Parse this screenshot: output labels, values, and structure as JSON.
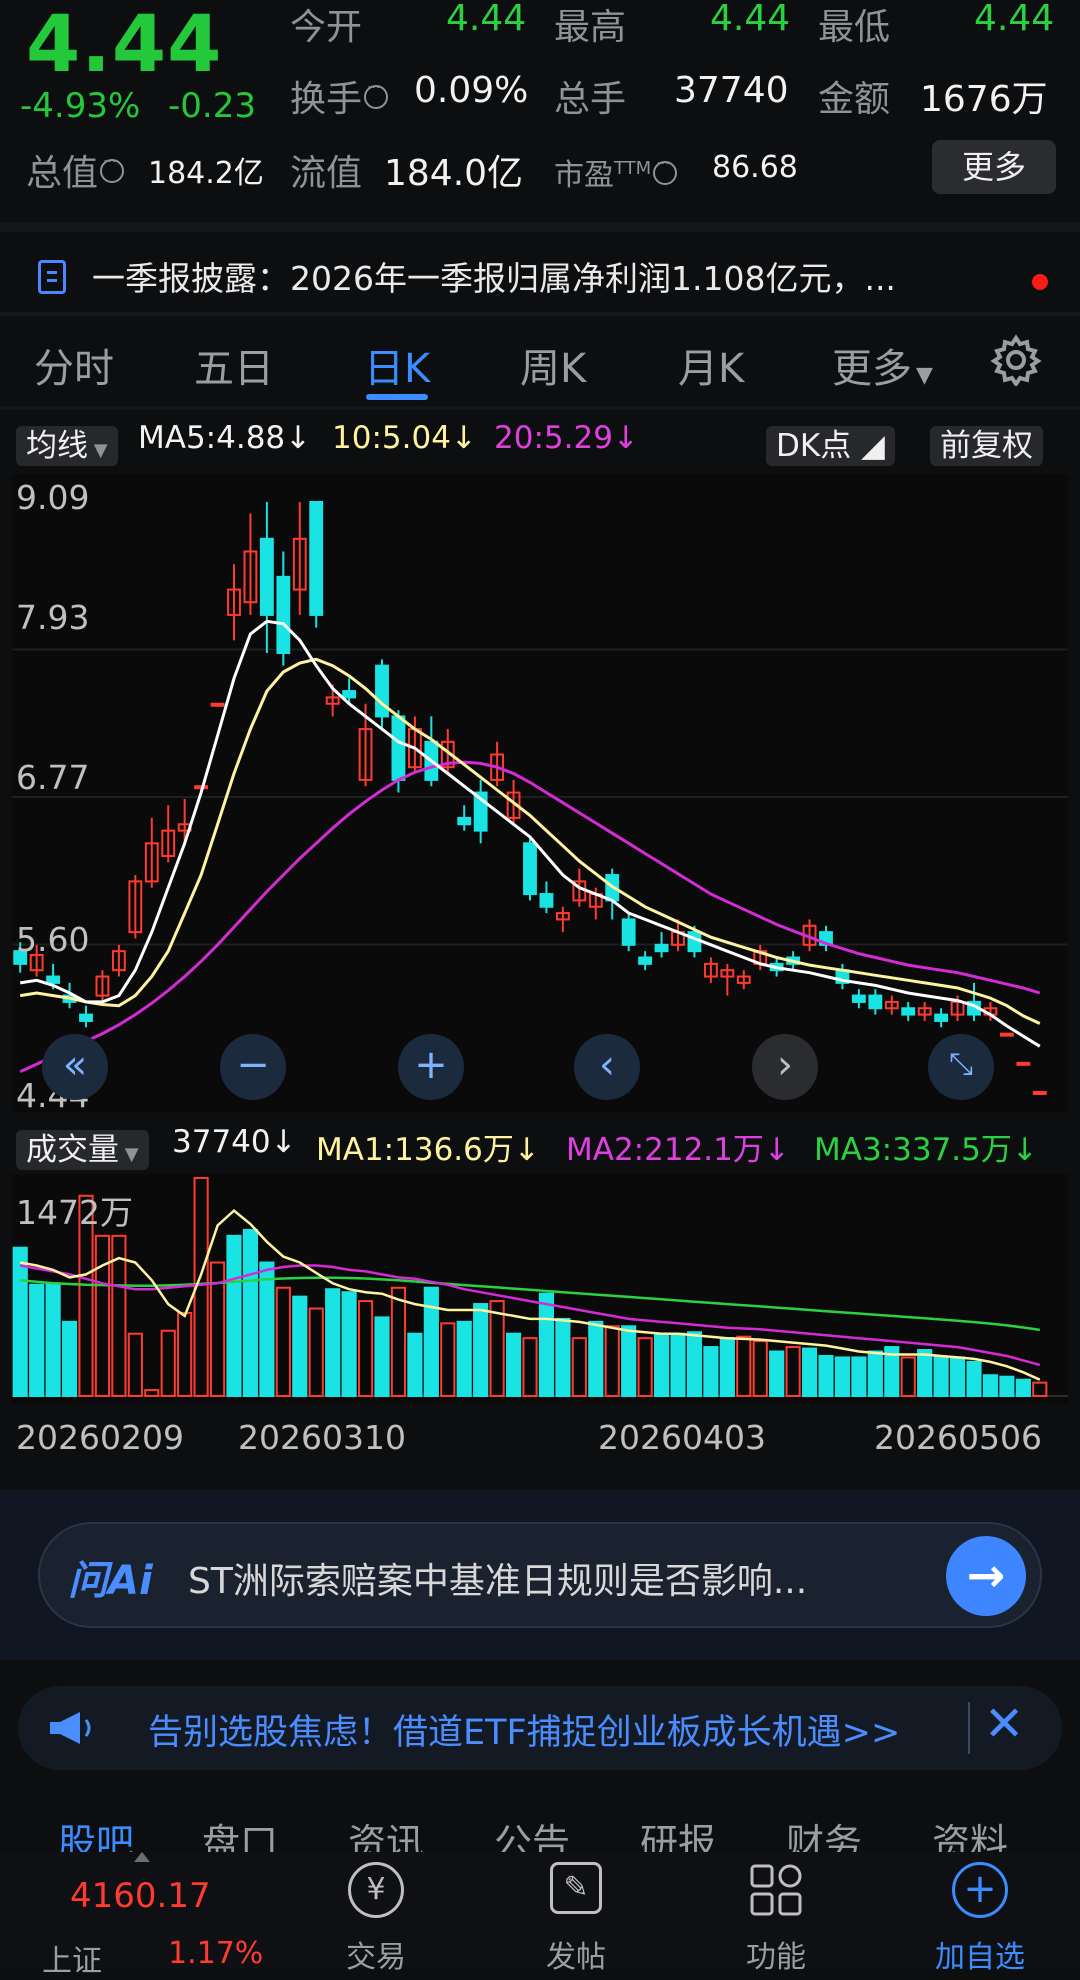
{
  "quote": {
    "price": "4.44",
    "change_pct": "-4.93%",
    "change_amt": "-0.23",
    "open_label": "今开",
    "open_value": "4.44",
    "high_label": "最高",
    "high_value": "4.44",
    "low_label": "最低",
    "low_value": "4.44",
    "turnover_label": "换手",
    "turnover_value": "0.09%",
    "volume_label": "总手",
    "volume_value": "37740",
    "amount_label": "金额",
    "amount_value": "1676万",
    "mcap_label": "总值",
    "mcap_value": "184.2亿",
    "float_label": "流值",
    "float_value": "184.0亿",
    "pe_label": "市盈",
    "pe_sup": "TTM",
    "pe_value": "86.68",
    "more_label": "更多"
  },
  "notice": {
    "text": "一季报披露：2026年一季报归属净利润1.108亿元，..."
  },
  "tabs": [
    "分时",
    "五日",
    "日K",
    "周K",
    "月K",
    "更多"
  ],
  "active_tab": "日K",
  "ma_row": {
    "selector": "均线",
    "ma5": "MA5:4.88",
    "ma10": "10:5.04",
    "ma20": "20:5.29",
    "dk": "DK点",
    "adjust": "前复权"
  },
  "price_axis": [
    "9.09",
    "7.93",
    "6.77",
    "5.60",
    "4.44"
  ],
  "vol_row": {
    "selector": "成交量",
    "vol": "37740",
    "ma1": "MA1:136.6万",
    "ma2": "MA2:212.1万",
    "ma3": "MA3:337.5万"
  },
  "vol_axis_max": "1472万",
  "dates": [
    "20260209",
    "20260310",
    "20260403",
    "20260506"
  ],
  "chart_data": {
    "type": "candlestick",
    "y_range": [
      4.44,
      9.09
    ],
    "candles": [
      [
        5.55,
        5.45,
        5.62,
        5.38
      ],
      [
        5.4,
        5.52,
        5.6,
        5.35
      ],
      [
        5.35,
        5.3,
        5.45,
        5.25
      ],
      [
        5.2,
        5.15,
        5.3,
        5.1
      ],
      [
        5.05,
        5.0,
        5.12,
        4.95
      ],
      [
        5.2,
        5.35,
        5.4,
        5.15
      ],
      [
        5.4,
        5.55,
        5.6,
        5.35
      ],
      [
        5.7,
        6.1,
        6.15,
        5.65
      ],
      [
        6.1,
        6.4,
        6.6,
        6.05
      ],
      [
        6.3,
        6.5,
        6.7,
        6.25
      ],
      [
        6.5,
        6.55,
        6.75,
        6.4
      ],
      [
        6.85,
        6.85,
        6.85,
        6.85
      ],
      [
        7.5,
        7.5,
        7.5,
        7.5
      ],
      [
        8.2,
        8.4,
        8.6,
        8.0
      ],
      [
        8.3,
        8.7,
        9.0,
        8.2
      ],
      [
        8.8,
        8.2,
        9.09,
        7.9
      ],
      [
        8.5,
        7.9,
        8.7,
        7.8
      ],
      [
        8.4,
        8.8,
        9.09,
        8.2
      ],
      [
        9.09,
        8.2,
        9.09,
        8.1
      ],
      [
        7.5,
        7.55,
        7.65,
        7.4
      ],
      [
        7.6,
        7.55,
        7.7,
        7.5
      ],
      [
        6.9,
        7.3,
        7.5,
        6.85
      ],
      [
        7.8,
        7.4,
        7.85,
        7.3
      ],
      [
        7.4,
        6.9,
        7.45,
        6.8
      ],
      [
        7.0,
        7.3,
        7.4,
        6.95
      ],
      [
        7.2,
        6.9,
        7.4,
        6.85
      ],
      [
        7.0,
        7.2,
        7.3,
        6.95
      ],
      [
        6.6,
        6.55,
        6.7,
        6.5
      ],
      [
        6.8,
        6.5,
        6.9,
        6.4
      ],
      [
        6.9,
        7.1,
        7.2,
        6.85
      ],
      [
        6.6,
        6.8,
        6.9,
        6.55
      ],
      [
        6.4,
        6.0,
        6.45,
        5.95
      ],
      [
        6.0,
        5.9,
        6.1,
        5.85
      ],
      [
        5.8,
        5.85,
        5.9,
        5.7
      ],
      [
        5.95,
        6.1,
        6.2,
        5.9
      ],
      [
        5.9,
        6.0,
        6.05,
        5.8
      ],
      [
        6.15,
        5.95,
        6.2,
        5.8
      ],
      [
        5.8,
        5.6,
        5.85,
        5.55
      ],
      [
        5.5,
        5.45,
        5.55,
        5.4
      ],
      [
        5.6,
        5.55,
        5.7,
        5.5
      ],
      [
        5.6,
        5.7,
        5.8,
        5.55
      ],
      [
        5.7,
        5.55,
        5.75,
        5.5
      ],
      [
        5.35,
        5.45,
        5.5,
        5.3
      ],
      [
        5.35,
        5.4,
        5.45,
        5.2
      ],
      [
        5.3,
        5.35,
        5.4,
        5.25
      ],
      [
        5.45,
        5.55,
        5.6,
        5.4
      ],
      [
        5.45,
        5.4,
        5.5,
        5.35
      ],
      [
        5.5,
        5.45,
        5.55,
        5.4
      ],
      [
        5.6,
        5.75,
        5.8,
        5.55
      ],
      [
        5.7,
        5.6,
        5.75,
        5.55
      ],
      [
        5.4,
        5.3,
        5.45,
        5.25
      ],
      [
        5.2,
        5.15,
        5.25,
        5.1
      ],
      [
        5.2,
        5.1,
        5.25,
        5.05
      ],
      [
        5.1,
        5.15,
        5.2,
        5.05
      ],
      [
        5.1,
        5.05,
        5.15,
        5.0
      ],
      [
        5.05,
        5.1,
        5.15,
        5.0
      ],
      [
        5.05,
        5.0,
        5.1,
        4.95
      ],
      [
        5.05,
        5.15,
        5.2,
        5.0
      ],
      [
        5.15,
        5.05,
        5.3,
        5.0
      ],
      [
        5.05,
        5.1,
        5.15,
        5.0
      ],
      [
        4.9,
        4.9,
        4.9,
        4.9
      ],
      [
        4.67,
        4.67,
        4.67,
        4.67
      ],
      [
        4.44,
        4.44,
        4.44,
        4.44
      ]
    ],
    "ma5": [
      5.3,
      5.32,
      5.28,
      5.22,
      5.15,
      5.15,
      5.2,
      5.4,
      5.7,
      6.05,
      6.4,
      6.8,
      7.25,
      7.7,
      8.05,
      8.15,
      8.13,
      8.0,
      7.8,
      7.62,
      7.5,
      7.4,
      7.3,
      7.2,
      7.15,
      7.05,
      6.95,
      6.85,
      6.75,
      6.65,
      6.55,
      6.45,
      6.3,
      6.15,
      6.05,
      6.0,
      5.95,
      5.85,
      5.8,
      5.75,
      5.7,
      5.65,
      5.6,
      5.55,
      5.5,
      5.45,
      5.42,
      5.4,
      5.38,
      5.35,
      5.32,
      5.3,
      5.28,
      5.25,
      5.22,
      5.2,
      5.18,
      5.16,
      5.12,
      5.05,
      4.96,
      4.88,
      4.8
    ],
    "ma10": [
      5.2,
      5.22,
      5.2,
      5.18,
      5.15,
      5.13,
      5.12,
      5.2,
      5.35,
      5.55,
      5.85,
      6.15,
      6.55,
      6.95,
      7.3,
      7.6,
      7.75,
      7.82,
      7.85,
      7.8,
      7.72,
      7.62,
      7.5,
      7.4,
      7.3,
      7.22,
      7.12,
      7.02,
      6.92,
      6.82,
      6.72,
      6.62,
      6.5,
      6.38,
      6.26,
      6.16,
      6.06,
      5.98,
      5.9,
      5.84,
      5.78,
      5.72,
      5.66,
      5.62,
      5.58,
      5.54,
      5.5,
      5.47,
      5.44,
      5.42,
      5.4,
      5.38,
      5.36,
      5.34,
      5.32,
      5.3,
      5.28,
      5.26,
      5.22,
      5.18,
      5.12,
      5.04,
      4.98
    ],
    "ma20": [
      4.6,
      4.66,
      4.72,
      4.78,
      4.84,
      4.9,
      4.97,
      5.05,
      5.14,
      5.24,
      5.35,
      5.47,
      5.6,
      5.74,
      5.88,
      6.02,
      6.15,
      6.28,
      6.4,
      6.52,
      6.63,
      6.73,
      6.82,
      6.9,
      6.96,
      7.0,
      7.03,
      7.04,
      7.03,
      7.0,
      6.95,
      6.88,
      6.8,
      6.72,
      6.64,
      6.56,
      6.48,
      6.4,
      6.32,
      6.24,
      6.16,
      6.08,
      6.0,
      5.94,
      5.88,
      5.82,
      5.76,
      5.71,
      5.66,
      5.61,
      5.57,
      5.53,
      5.5,
      5.47,
      5.44,
      5.42,
      5.4,
      5.38,
      5.35,
      5.32,
      5.29,
      5.26,
      5.22
    ],
    "volumes": [
      1000,
      750,
      760,
      500,
      1350,
      1080,
      1080,
      420,
      40,
      440,
      560,
      1470,
      900,
      1080,
      1120,
      900,
      730,
      670,
      590,
      720,
      700,
      640,
      530,
      730,
      420,
      730,
      490,
      500,
      620,
      640,
      420,
      390,
      690,
      520,
      390,
      500,
      470,
      470,
      390,
      420,
      420,
      430,
      330,
      390,
      400,
      370,
      300,
      330,
      320,
      270,
      260,
      260,
      300,
      330,
      260,
      310,
      260,
      260,
      230,
      140,
      130,
      110,
      90
    ],
    "volume_up": [
      false,
      false,
      false,
      false,
      true,
      true,
      true,
      true,
      true,
      true,
      true,
      true,
      true,
      false,
      false,
      false,
      true,
      false,
      true,
      false,
      false,
      true,
      false,
      true,
      false,
      false,
      true,
      false,
      false,
      true,
      false,
      true,
      false,
      false,
      true,
      false,
      true,
      false,
      true,
      false,
      false,
      false,
      false,
      false,
      true,
      true,
      false,
      true,
      false,
      false,
      false,
      false,
      false,
      false,
      true,
      false,
      false,
      false,
      false,
      false,
      false,
      false,
      true
    ],
    "vol_ma1": [
      900,
      880,
      850,
      800,
      820,
      880,
      930,
      900,
      780,
      620,
      540,
      820,
      1150,
      1250,
      1160,
      1040,
      940,
      900,
      830,
      760,
      720,
      700,
      690,
      650,
      620,
      600,
      580,
      580,
      580,
      560,
      540,
      520,
      520,
      510,
      500,
      480,
      460,
      440,
      430,
      420,
      420,
      410,
      400,
      390,
      385,
      380,
      370,
      360,
      350,
      340,
      320,
      300,
      290,
      280,
      280,
      280,
      270,
      260,
      250,
      230,
      200,
      160,
      110
    ],
    "vol_ma2": [
      880,
      860,
      840,
      820,
      790,
      760,
      740,
      720,
      720,
      730,
      740,
      750,
      760,
      790,
      820,
      850,
      870,
      880,
      880,
      870,
      850,
      840,
      820,
      800,
      790,
      770,
      750,
      720,
      700,
      680,
      660,
      640,
      620,
      600,
      580,
      560,
      540,
      520,
      510,
      500,
      490,
      480,
      470,
      460,
      455,
      450,
      440,
      430,
      420,
      410,
      400,
      390,
      380,
      370,
      360,
      350,
      340,
      330,
      310,
      290,
      270,
      240,
      210
    ],
    "vol_ma3": [
      780,
      770,
      760,
      755,
      750,
      748,
      746,
      744,
      744,
      746,
      750,
      756,
      762,
      770,
      778,
      786,
      792,
      796,
      798,
      798,
      796,
      792,
      786,
      780,
      772,
      764,
      756,
      748,
      740,
      732,
      724,
      716,
      708,
      700,
      692,
      684,
      676,
      668,
      660,
      652,
      644,
      636,
      628,
      620,
      612,
      604,
      596,
      588,
      580,
      572,
      564,
      556,
      548,
      540,
      532,
      524,
      516,
      508,
      498,
      488,
      476,
      462,
      446
    ]
  },
  "ai": {
    "logo": "问Ai",
    "text": "ST洲际索赔案中基准日规则是否影响..."
  },
  "ad": {
    "text": "告别选股焦虑！借道ETF捕捉创业板成长机遇>>"
  },
  "bottom_tabs": [
    "股吧",
    "盘口",
    "资讯",
    "公告",
    "研报",
    "财务",
    "资料"
  ],
  "bottom_bar": {
    "index_value": "4160.17",
    "index_name": "上证",
    "index_change": "1.17%",
    "trade": "交易",
    "post": "发帖",
    "function": "功能",
    "add": "加自选"
  },
  "colors": {
    "up": "#ff3b30",
    "down": "#19e3e3",
    "ma5": "#ffffff",
    "ma10": "#fff3a0",
    "ma20": "#d42bd4",
    "vol_ma3": "#2bd141",
    "accent": "#3a8cff"
  }
}
